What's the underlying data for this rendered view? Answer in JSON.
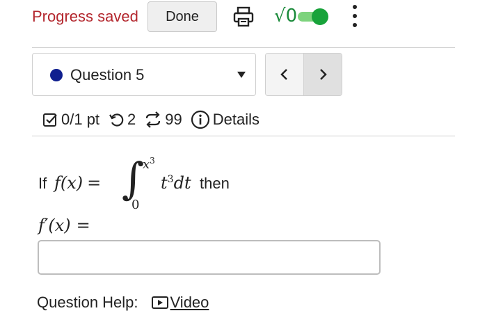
{
  "toolbar": {
    "status": "Progress saved",
    "done_label": "Done",
    "print_icon": "printer-icon",
    "math_toggle_label": "√0",
    "math_toggle_on": true,
    "more_icon": "kebab-menu-icon"
  },
  "question_nav": {
    "selected": "Question 5",
    "status_color": "#0f1f8f",
    "prev_symbol": "‹",
    "next_symbol": "›"
  },
  "meta": {
    "score": "0/1 pt",
    "attempts": "2",
    "versions": "99",
    "details_label": "Details"
  },
  "question": {
    "prefix": "If",
    "lhs": "f(x)",
    "equals": "=",
    "integral_sign": "∫",
    "upper_base": "x",
    "upper_exp": "3",
    "lower": "0",
    "integrand_base": "t",
    "integrand_exp": "3",
    "differential": "dt",
    "suffix": "then",
    "prompt_lhs": "f′(x)",
    "prompt_eq": "="
  },
  "answer": {
    "value": "",
    "placeholder": ""
  },
  "help": {
    "label": "Question Help:",
    "video_label": "Video"
  },
  "colors": {
    "status": "#b3262d",
    "toggle": "#18a33a",
    "accent": "#0f1f8f"
  }
}
